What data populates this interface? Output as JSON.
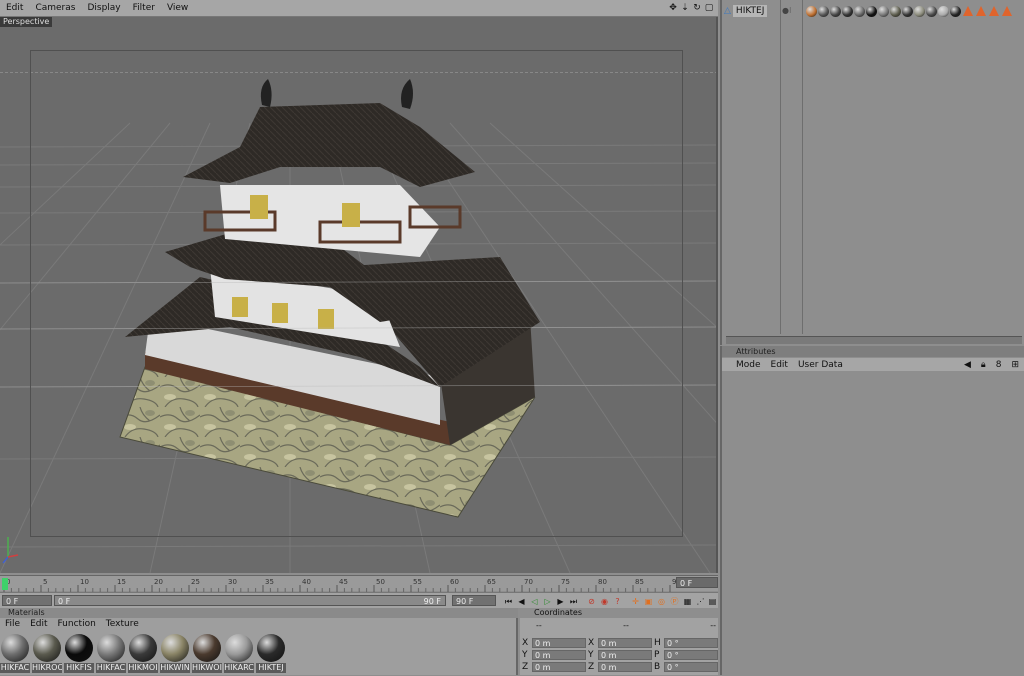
{
  "menu": [
    "Edit",
    "Cameras",
    "Display",
    "Filter",
    "View"
  ],
  "viewport": {
    "label": "Perspective"
  },
  "timeline": {
    "ticks": [
      "0",
      "5",
      "10",
      "15",
      "20",
      "25",
      "30",
      "35",
      "40",
      "45",
      "50",
      "55",
      "60",
      "65",
      "70",
      "75",
      "80",
      "85",
      "90"
    ],
    "current_frame": "0 F"
  },
  "transport": {
    "start": "0 F",
    "preview_start": "0 F",
    "preview_end": "90 F",
    "end": "90 F"
  },
  "materials": {
    "title": "Materials",
    "menu": [
      "File",
      "Edit",
      "Function",
      "Texture"
    ],
    "items": [
      {
        "name": "HIKFAC",
        "color": "#6e6e6e"
      },
      {
        "name": "HIKROO",
        "color": "#5a5a4e"
      },
      {
        "name": "HIKFIS",
        "color": "#0a0a0a"
      },
      {
        "name": "HIKFAC",
        "color": "#7a7a7a"
      },
      {
        "name": "HIKMOI",
        "color": "#3a3a3a"
      },
      {
        "name": "HIKWIN",
        "color": "#8a8466"
      },
      {
        "name": "HIKWOI",
        "color": "#4a3a2e"
      },
      {
        "name": "HIKARC",
        "color": "#9a9a9a"
      },
      {
        "name": "HIKTEJ",
        "color": "#2a2a2a"
      }
    ]
  },
  "coordinates": {
    "title": "Coordinates",
    "cols": [
      "--",
      "--",
      "--"
    ],
    "rows": [
      {
        "a": "X",
        "av": "0 m",
        "b": "X",
        "bv": "0 m",
        "c": "H",
        "cv": "0 °"
      },
      {
        "a": "Y",
        "av": "0 m",
        "b": "Y",
        "bv": "0 m",
        "c": "P",
        "cv": "0 °"
      },
      {
        "a": "Z",
        "av": "0 m",
        "b": "Z",
        "bv": "0 m",
        "c": "B",
        "cv": "0 °"
      }
    ]
  },
  "object_manager": {
    "object_name": "HIKTEJ",
    "tag_colors": [
      "#c07030",
      "#555",
      "#444",
      "#333",
      "#666",
      "#111",
      "#777",
      "#5a5a4a",
      "#333",
      "#8a8a7a",
      "#4a4a4a",
      "#aaa",
      "#222"
    ]
  },
  "attributes": {
    "title": "Attributes",
    "menu": [
      "Mode",
      "Edit",
      "User Data"
    ],
    "count": "8"
  }
}
